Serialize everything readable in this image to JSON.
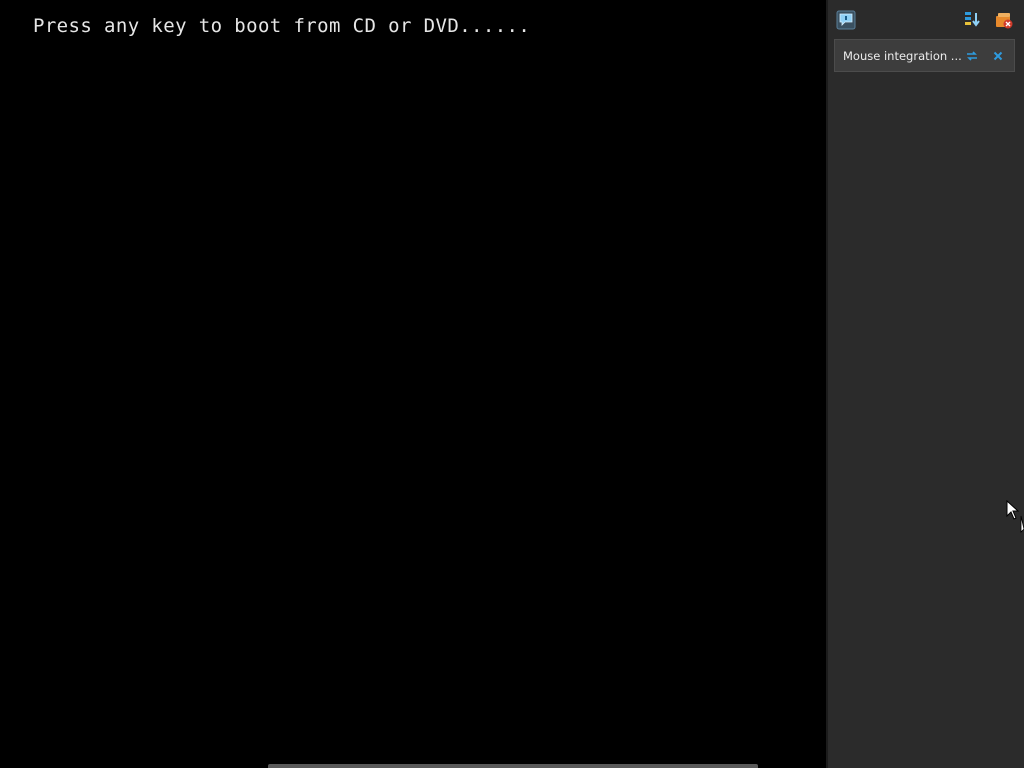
{
  "vm": {
    "boot_message": "Press any key to boot from CD or DVD......"
  },
  "side_panel": {
    "toolbar": {
      "left_icon": "message-balloon-icon",
      "right_icons": [
        "sort-order-icon",
        "clear-notifications-icon"
      ]
    },
    "notifications": [
      {
        "text": "Mouse integration ...",
        "actions": [
          "toggle-icon",
          "close-icon"
        ]
      }
    ]
  },
  "colors": {
    "vm_background": "#000000",
    "panel_background": "#2b2b2b",
    "notification_background": "#3d3d3d",
    "accent_blue": "#2e9bde",
    "accent_orange": "#e88a2c"
  }
}
